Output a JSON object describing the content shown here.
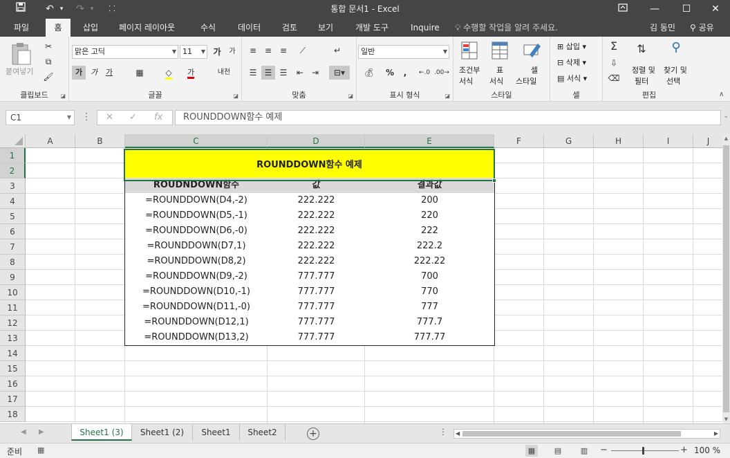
{
  "window": {
    "title": "통합 문서1 - Excel",
    "qat": {
      "undo_dropdown": "▾",
      "redo_dropdown": "▾",
      "customize": "⸬"
    }
  },
  "tabs": [
    {
      "label": "파일"
    },
    {
      "label": "홈"
    },
    {
      "label": "삽입"
    },
    {
      "label": "페이지 레이아웃"
    },
    {
      "label": "수식"
    },
    {
      "label": "데이터"
    },
    {
      "label": "검토"
    },
    {
      "label": "보기"
    },
    {
      "label": "개발 도구"
    },
    {
      "label": "Inquire"
    }
  ],
  "tellme": "수행할 작업을 알려 주세요.",
  "user": "김 동민",
  "share": "공유",
  "ribbon": {
    "clipboard": {
      "label": "클립보드",
      "paste": "붙여넣기"
    },
    "font": {
      "label": "글꼴",
      "name": "맑은 고딕",
      "size": "11",
      "grow": "가",
      "shrink": "가",
      "bold": "가",
      "italic": "가",
      "underline": "가",
      "fontcolor": "가",
      "phonetic": "내천"
    },
    "align": {
      "label": "맞춤"
    },
    "number": {
      "label": "표시 형식",
      "format": "일반",
      "percent": "%",
      "comma": ","
    },
    "styles": {
      "label": "스타일",
      "cond_top": "조건부",
      "cond_bottom": "서식",
      "table_top": "표",
      "table_bottom": "서식",
      "cell_top": "셀",
      "cell_bottom": "스타일"
    },
    "cells": {
      "label": "셀",
      "insert": "삽입",
      "delete": "삭제",
      "format": "서식"
    },
    "edit": {
      "label": "편집",
      "sort_top": "정렬 및",
      "sort_bottom": "필터",
      "find_top": "찾기 및",
      "find_bottom": "선택"
    }
  },
  "formula_bar": {
    "name_box": "C1",
    "formula": "ROUNDDOWN함수 예제"
  },
  "columns": [
    "A",
    "B",
    "C",
    "D",
    "E",
    "F",
    "G",
    "H",
    "I",
    "J"
  ],
  "rows": [
    "1",
    "2",
    "3",
    "4",
    "5",
    "6",
    "7",
    "8",
    "9",
    "10",
    "11",
    "12",
    "13",
    "14",
    "15",
    "16",
    "17",
    "18"
  ],
  "table": {
    "title": "ROUNDDOWN함수 예제",
    "headers": [
      "ROUDNDOWN함수",
      "값",
      "결과값"
    ],
    "rows": [
      [
        "=ROUNDDOWN(D4,-2)",
        "222.222",
        "200"
      ],
      [
        "=ROUNDDOWN(D5,-1)",
        "222.222",
        "220"
      ],
      [
        "=ROUNDDOWN(D6,-0)",
        "222.222",
        "222"
      ],
      [
        "=ROUNDDOWN(D7,1)",
        "222.222",
        "222.2"
      ],
      [
        "=ROUNDDOWN(D8,2)",
        "222.222",
        "222.22"
      ],
      [
        "=ROUNDDOWN(D9,-2)",
        "777.777",
        "700"
      ],
      [
        "=ROUNDDOWN(D10,-1)",
        "777.777",
        "770"
      ],
      [
        "=ROUNDDOWN(D11,-0)",
        "777.777",
        "777"
      ],
      [
        "=ROUNDDOWN(D12,1)",
        "777.777",
        "777.7"
      ],
      [
        "=ROUNDDOWN(D13,2)",
        "777.777",
        "777.77"
      ]
    ]
  },
  "sheets": [
    {
      "label": "Sheet1 (3)"
    },
    {
      "label": "Sheet1 (2)"
    },
    {
      "label": "Sheet1"
    },
    {
      "label": "Sheet2"
    }
  ],
  "status": {
    "ready": "준비",
    "zoom": "100 %"
  }
}
